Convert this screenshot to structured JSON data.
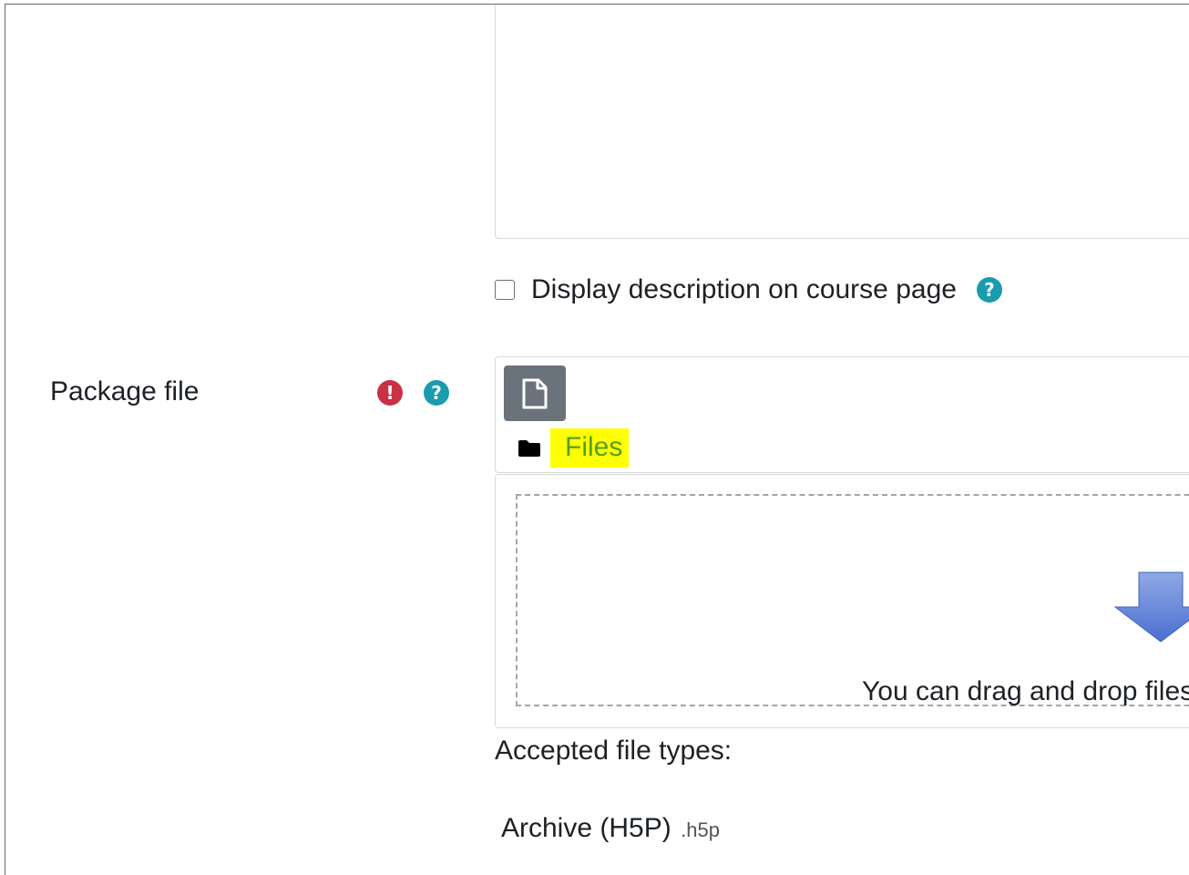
{
  "description_editor": {
    "value": ""
  },
  "display_description": {
    "label": "Display description on course page",
    "checked": false,
    "help_icon": "question-circle-icon"
  },
  "package_file": {
    "label": "Package file",
    "required_icon": "exclamation-circle-icon",
    "help_icon": "question-circle-icon",
    "add_button_icon": "file-icon",
    "folder_icon": "folder-icon",
    "path_label": "Files",
    "drop_icon": "down-arrow-icon",
    "drop_text": "You can drag and drop files"
  },
  "accepted_types": {
    "label": "Accepted file types:",
    "items": [
      {
        "name": "Archive (H5P)",
        "ext": ".h5p"
      }
    ]
  },
  "colors": {
    "help_icon": "#1a9bb0",
    "required_icon": "#ca3145",
    "add_button": "#6a737b",
    "highlight": "#ffff00",
    "files_link": "#52a01e",
    "drop_arrow": "#5b7fd6"
  }
}
